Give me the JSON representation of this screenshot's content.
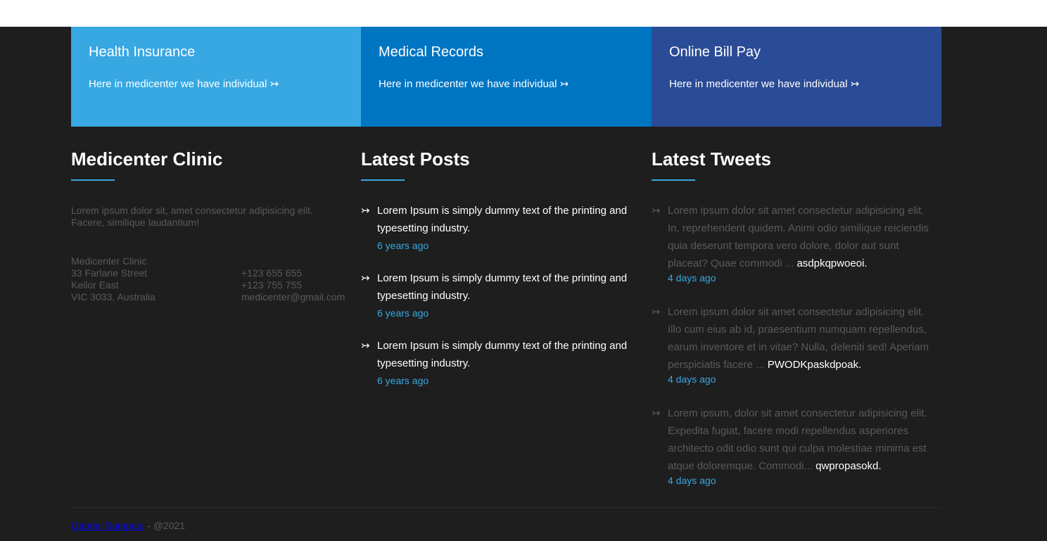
{
  "boxes": [
    {
      "title": "Health Insurance",
      "link": "Here in medicenter we have individual ↣"
    },
    {
      "title": "Medical Records",
      "link": "Here in medicenter we have individual ↣"
    },
    {
      "title": "Online Bill Pay",
      "link": "Here in medicenter we have individual ↣"
    }
  ],
  "about": {
    "title": "Medicenter Clinic",
    "text": "Lorem ipsum dolor sit, amet consectetur adipisicing elit. Facere, similique laudantium!",
    "address": [
      "Medicenter Clinic",
      "33 Farlane Street",
      "Keilor East",
      "VIC 3033, Australia"
    ],
    "contacts": [
      "+123 655 655",
      "+123 755 755",
      "medicenter@gmail.com"
    ]
  },
  "posts": {
    "title": "Latest Posts",
    "items": [
      {
        "text": "Lorem Ipsum is simply dummy text of the printing and typesetting industry.",
        "date": "6 years ago"
      },
      {
        "text": "Lorem Ipsum is simply dummy text of the printing and typesetting industry.",
        "date": "6 years ago"
      },
      {
        "text": "Lorem Ipsum is simply dummy text of the printing and typesetting industry.",
        "date": "6 years ago"
      }
    ]
  },
  "tweets": {
    "title": "Latest Tweets",
    "items": [
      {
        "text": "Lorem ipsum dolor sit amet consectetur adipisicing elit. In, reprehenderit quidem. Animi odio similique reiciendis quia deserunt tempora vero dolore, dolor aut sunt placeat? Quae commodi ...",
        "handle": "asdpkqpwoeoi.",
        "date": "4 days ago"
      },
      {
        "text": "Lorem ipsum dolor sit amet consectetur adipisicing elit. Illo cum eius ab id, praesentium numquam repellendus, earum inventore et in vitae? Nulla, deleniti sed! Aperiam perspiciatis facere ...",
        "handle": "PWODKpaskdpoak.",
        "date": "4 days ago"
      },
      {
        "text": "Lorem ipsum, dolor sit amet consectetur adipisicing elit. Expedita fugiat, facere modi repellendus asperiores architecto odit odio sunt qui culpa molestiae minima est atque doloremque. Commodi...",
        "handle": "qwpropasokd.",
        "date": "4 days ago"
      }
    ]
  },
  "footer": {
    "author_link": "Gabriel Sampaio",
    "suffix": " - @2021"
  },
  "icons": {
    "bullet": "rightwards-arrow-with-tail-icon"
  },
  "colors": {
    "background": "#1e1e1e",
    "accent": "#37a8e2",
    "box_1": "#37a8e2",
    "box_2": "#0075c2",
    "box_3": "#2a4b96",
    "muted_text": "#5a5a5a",
    "link": "#0000ee"
  }
}
